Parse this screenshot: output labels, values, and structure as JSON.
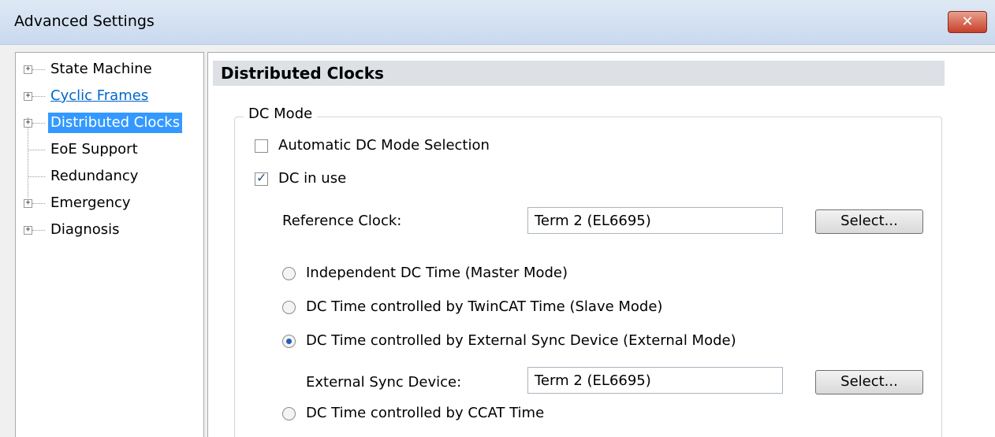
{
  "window": {
    "title": "Advanced Settings",
    "close_label": "✕"
  },
  "tree": {
    "items": [
      {
        "label": "State Machine",
        "expandable": true
      },
      {
        "label": "Cyclic Frames",
        "expandable": true,
        "link": true
      },
      {
        "label": "Distributed Clocks",
        "expandable": true,
        "selected": true
      },
      {
        "label": "EoE Support",
        "expandable": false
      },
      {
        "label": "Redundancy",
        "expandable": false
      },
      {
        "label": "Emergency",
        "expandable": true
      },
      {
        "label": "Diagnosis",
        "expandable": true
      }
    ],
    "expander_glyph": "+"
  },
  "panel": {
    "title": "Distributed Clocks",
    "group_title": "DC Mode",
    "auto_dc": {
      "label": "Automatic DC Mode Selection",
      "checked": false
    },
    "dc_in_use": {
      "label": "DC in use",
      "checked": true
    },
    "reference_clock": {
      "label": "Reference Clock:",
      "value": "Term 2 (EL6695)",
      "button": "Select..."
    },
    "modes": [
      {
        "label": "Independent DC Time (Master Mode)",
        "selected": false
      },
      {
        "label": "DC Time controlled by TwinCAT Time (Slave Mode)",
        "selected": false
      },
      {
        "label": "DC Time controlled by External Sync Device (External Mode)",
        "selected": true
      },
      {
        "label": "DC Time controlled by CCAT Time",
        "selected": false
      }
    ],
    "external_sync": {
      "label": "External Sync Device:",
      "value": "Term 2 (EL6695)",
      "button": "Select..."
    }
  }
}
